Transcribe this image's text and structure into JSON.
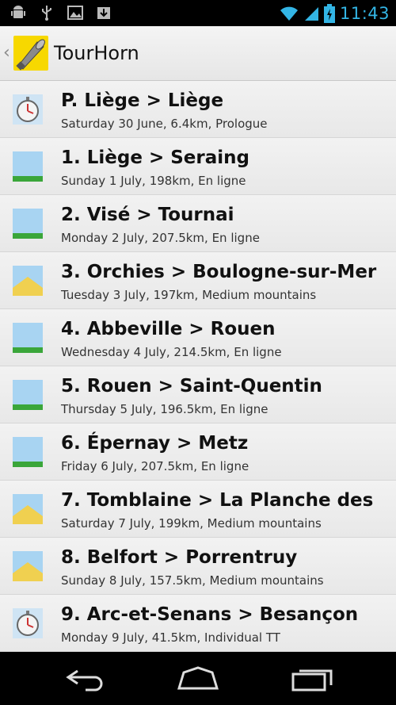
{
  "status_bar": {
    "time": "11:43"
  },
  "action_bar": {
    "title": "TourHorn"
  },
  "stages": [
    {
      "title": "P. Liège > Liège",
      "subtitle": "Saturday 30 June, 6.4km, Prologue",
      "icon": "stopwatch-icon"
    },
    {
      "title": "1. Liège > Seraing",
      "subtitle": "Sunday 1 July, 198km, En ligne",
      "icon": "flat-stage-icon"
    },
    {
      "title": "2. Visé > Tournai",
      "subtitle": "Monday 2 July, 207.5km, En ligne",
      "icon": "flat-stage-icon"
    },
    {
      "title": "3. Orchies > Boulogne-sur-Mer",
      "subtitle": "Tuesday 3 July, 197km, Medium mountains",
      "icon": "hill-stage-icon"
    },
    {
      "title": "4. Abbeville > Rouen",
      "subtitle": "Wednesday 4 July, 214.5km, En ligne",
      "icon": "flat-stage-icon"
    },
    {
      "title": "5. Rouen > Saint-Quentin",
      "subtitle": "Thursday 5 July, 196.5km, En ligne",
      "icon": "flat-stage-icon"
    },
    {
      "title": "6. Épernay > Metz",
      "subtitle": "Friday 6 July, 207.5km, En ligne",
      "icon": "flat-stage-icon"
    },
    {
      "title": "7. Tomblaine > La Planche des",
      "subtitle": "Saturday 7 July, 199km, Medium mountains",
      "icon": "hill-stage-icon"
    },
    {
      "title": "8. Belfort > Porrentruy",
      "subtitle": "Sunday 8 July, 157.5km, Medium mountains",
      "icon": "hill-stage-icon"
    },
    {
      "title": "9. Arc-et-Senans > Besançon",
      "subtitle": "Monday 9 July, 41.5km, Individual TT",
      "icon": "stopwatch-icon"
    }
  ],
  "colors": {
    "accent": "#33b5e5",
    "flat_green": "#3aa63a",
    "hill_yellow": "#f0d050",
    "sky_blue": "#a8d4f2"
  }
}
